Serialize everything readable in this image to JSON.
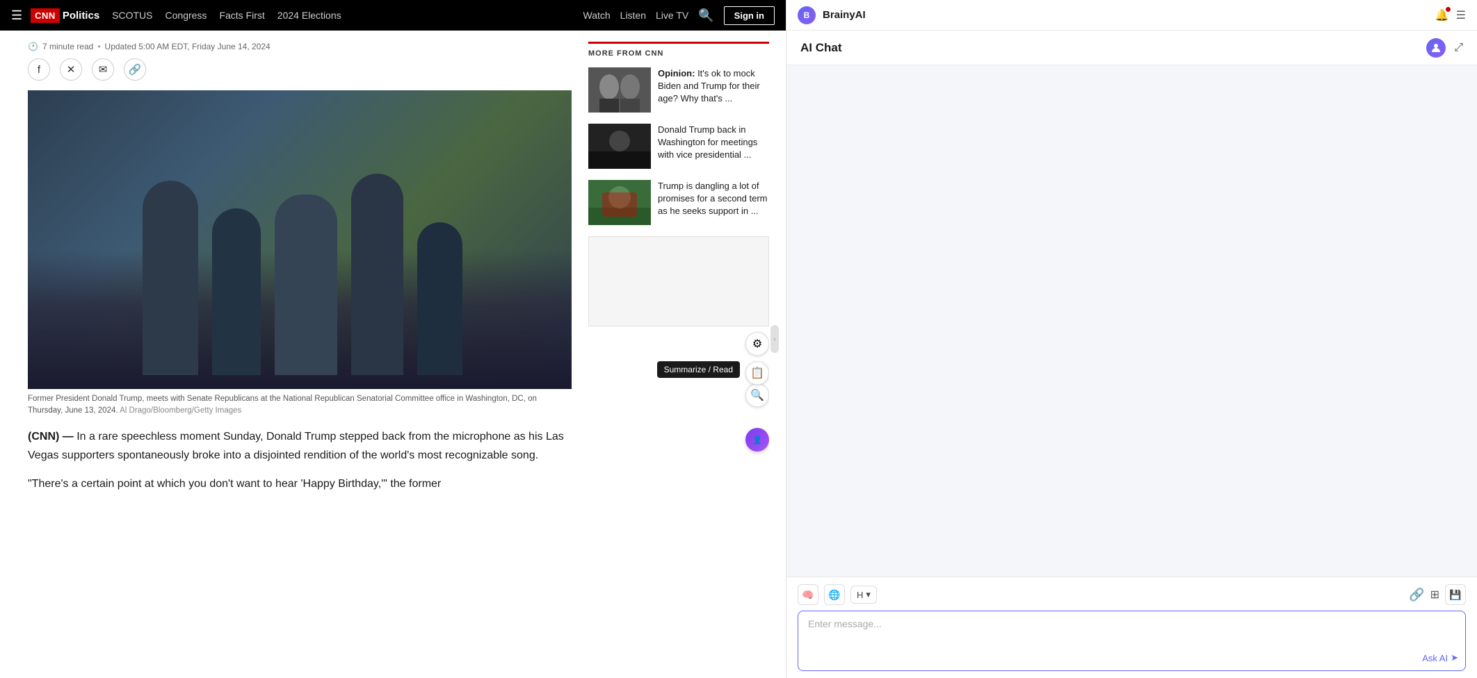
{
  "cnn": {
    "logo": "CNN",
    "section": "Politics",
    "nav_links": [
      "SCOTUS",
      "Congress",
      "Facts First",
      "2024 Elections"
    ],
    "nav_right": [
      "Watch",
      "Listen",
      "Live TV"
    ],
    "signin_label": "Sign in",
    "article": {
      "meta_read": "7 minute read",
      "meta_updated": "Updated 5:00 AM EDT, Friday June 14, 2024",
      "image_caption": "Former President Donald Trump, meets with Senate Republicans at the National Republican Senatorial Committee office in Washington, DC, on Thursday, June 13, 2024.",
      "image_credit": "Al Drago/Bloomberg/Getty Images",
      "body_lead": "(CNN) —",
      "body_text": " In a rare speechless moment Sunday, Donald Trump stepped back from the microphone as his Las Vegas supporters spontaneously broke into a disjointed rendition of the world's most recognizable song.",
      "body_text_2": "\"There's a certain point at which you don't want to hear 'Happy Birthday,'\" the former"
    },
    "sidebar": {
      "more_from_cnn_label": "MORE FROM CNN",
      "cards": [
        {
          "label": "Opinion:",
          "text": "It's ok to mock Biden and Trump for their age? Why that's ..."
        },
        {
          "text": "Donald Trump back in Washington for meetings with vice presidential ..."
        },
        {
          "text": "Trump is dangling a lot of promises for a second term as he seeks support in ..."
        }
      ]
    },
    "summarize_tooltip": "Summarize / Read"
  },
  "brainy": {
    "app_name": "BrainyAI",
    "header_title": "AI Chat",
    "message_placeholder": "Enter message...",
    "ask_ai_label": "Ask AI",
    "toolbar_icons": [
      "🧠",
      "🌐",
      "H",
      "▾",
      "🔗",
      "⊞"
    ],
    "send_icon": "➤"
  }
}
